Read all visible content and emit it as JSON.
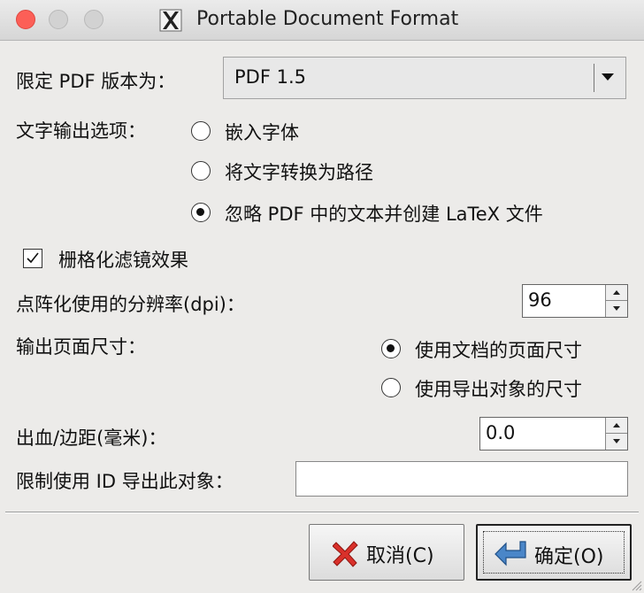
{
  "window": {
    "title": "Portable Document Format"
  },
  "version": {
    "label": "限定 PDF 版本为：",
    "selected": "PDF 1.5"
  },
  "text_output": {
    "label": "文字输出选项：",
    "options": [
      {
        "label": "嵌入字体",
        "selected": false
      },
      {
        "label": "将文字转换为路径",
        "selected": false
      },
      {
        "label": "忽略 PDF 中的文本并创建 LaTeX 文件",
        "selected": true
      }
    ]
  },
  "rasterize": {
    "label": "栅格化滤镜效果",
    "checked": true
  },
  "resolution": {
    "label": "点阵化使用的分辨率(dpi)：",
    "value": "96"
  },
  "page_size": {
    "label": "输出页面尺寸：",
    "options": [
      {
        "label": "使用文档的页面尺寸",
        "selected": true
      },
      {
        "label": "使用导出对象的尺寸",
        "selected": false
      }
    ]
  },
  "bleed": {
    "label": "出血/边距(毫米)：",
    "value": "0.0"
  },
  "export_id": {
    "label": "限制使用 ID 导出此对象：",
    "value": ""
  },
  "buttons": {
    "cancel": "取消(C)",
    "ok": "确定(O)"
  },
  "icons": {
    "app": "x11-icon",
    "cancel": "red-x-icon",
    "ok": "return-arrow-icon"
  },
  "colors": {
    "background": "#ecebe9",
    "close_light": "#fc5f57",
    "ok_arrow": "#4a86c8",
    "cancel_x": "#d9302a"
  }
}
